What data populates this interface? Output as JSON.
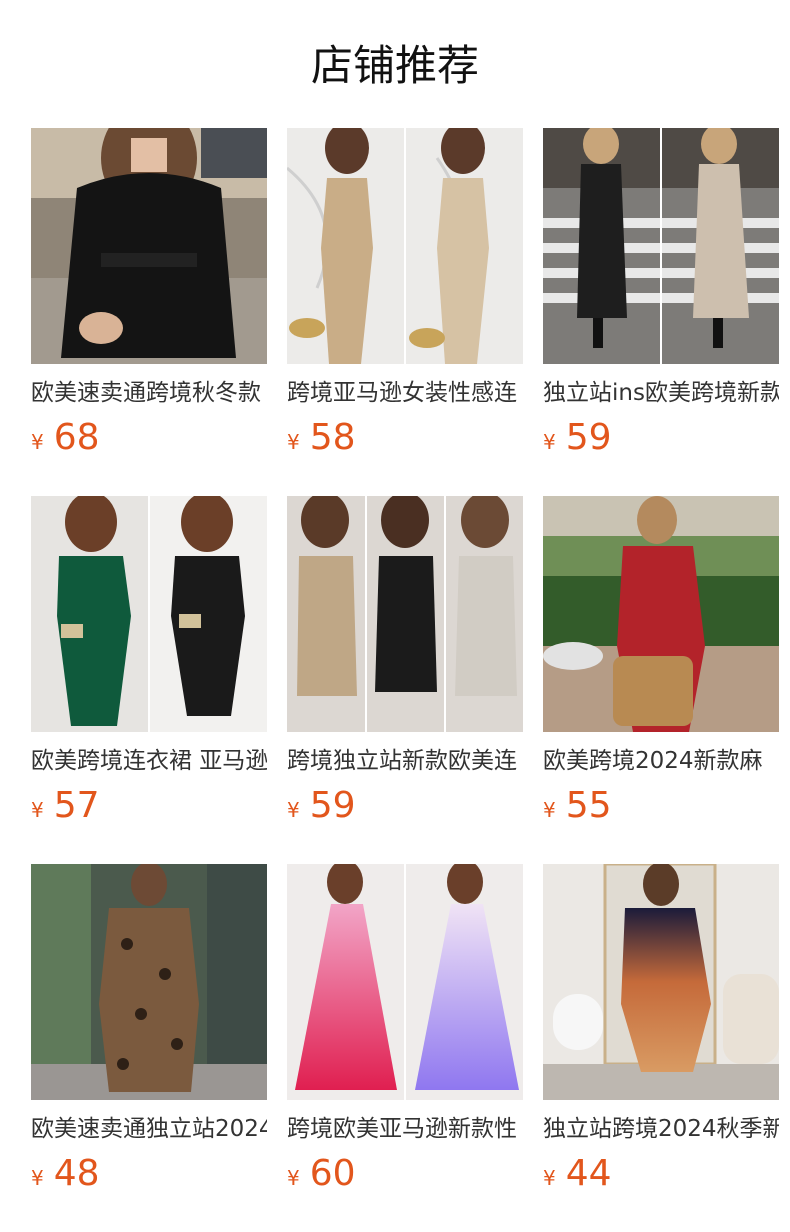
{
  "header": {
    "title": "店铺推荐"
  },
  "products": [
    {
      "name": "欧美速卖通跨境秋冬款",
      "currency": "¥",
      "price": "68",
      "image": "woman-black-belted-coat-street-photo"
    },
    {
      "name": "跨境亚马逊女装性感连",
      "currency": "¥",
      "price": "58",
      "image": "woman-gold-sequin-slit-dress-photo"
    },
    {
      "name": "独立站ins欧美跨境新款",
      "currency": "¥",
      "price": "59",
      "image": "woman-sequin-long-dress-street-photo"
    },
    {
      "name": "欧美跨境连衣裙 亚马逊",
      "currency": "¥",
      "price": "57",
      "image": "woman-green-black-sequin-dress-photo"
    },
    {
      "name": "跨境独立站新款欧美连",
      "currency": "¥",
      "price": "59",
      "image": "woman-sequin-mini-dress-trio-photo"
    },
    {
      "name": "欧美跨境2024新款麻",
      "currency": "¥",
      "price": "55",
      "image": "woman-red-dress-garden-photo"
    },
    {
      "name": "欧美速卖通独立站2024",
      "currency": "¥",
      "price": "48",
      "image": "woman-leopard-print-dress-photo"
    },
    {
      "name": "跨境欧美亚马逊新款性",
      "currency": "¥",
      "price": "60",
      "image": "woman-gradient-pleated-maxi-dress-photo"
    },
    {
      "name": "独立站跨境2024秋季新",
      "currency": "¥",
      "price": "44",
      "image": "woman-ombre-wrap-dress-photo"
    }
  ]
}
